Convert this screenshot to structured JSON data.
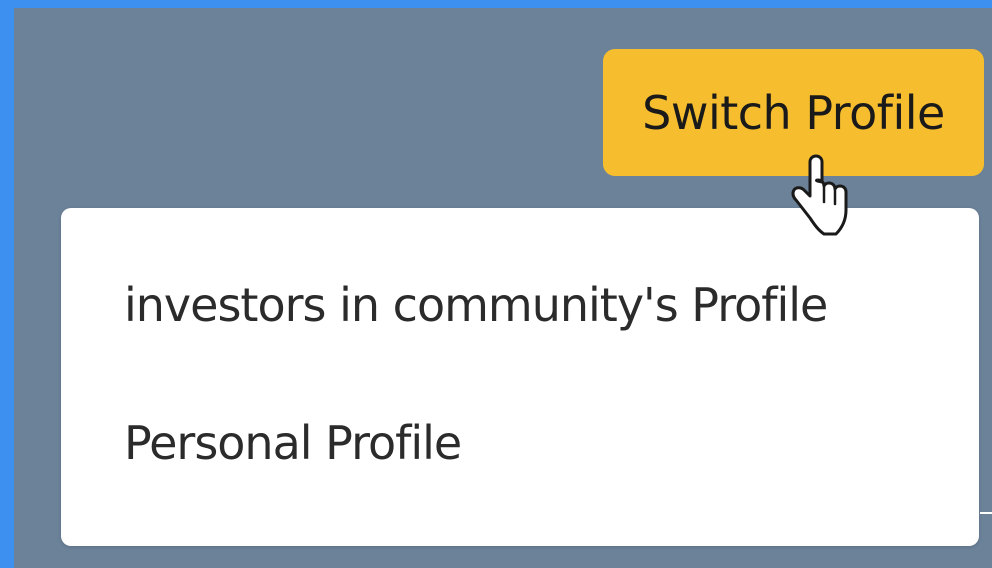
{
  "header": {
    "switch_profile_label": "Switch Profile"
  },
  "dropdown": {
    "items": [
      {
        "label": "investors in community's Profile"
      },
      {
        "label": "Personal Profile"
      }
    ]
  },
  "colors": {
    "outer_border": "#3d8ff0",
    "background": "#6b8299",
    "button": "#f6be2e",
    "dropdown": "#ffffff",
    "text": "#2b2b2b"
  },
  "icons": {
    "cursor": "hand-pointer-icon"
  }
}
